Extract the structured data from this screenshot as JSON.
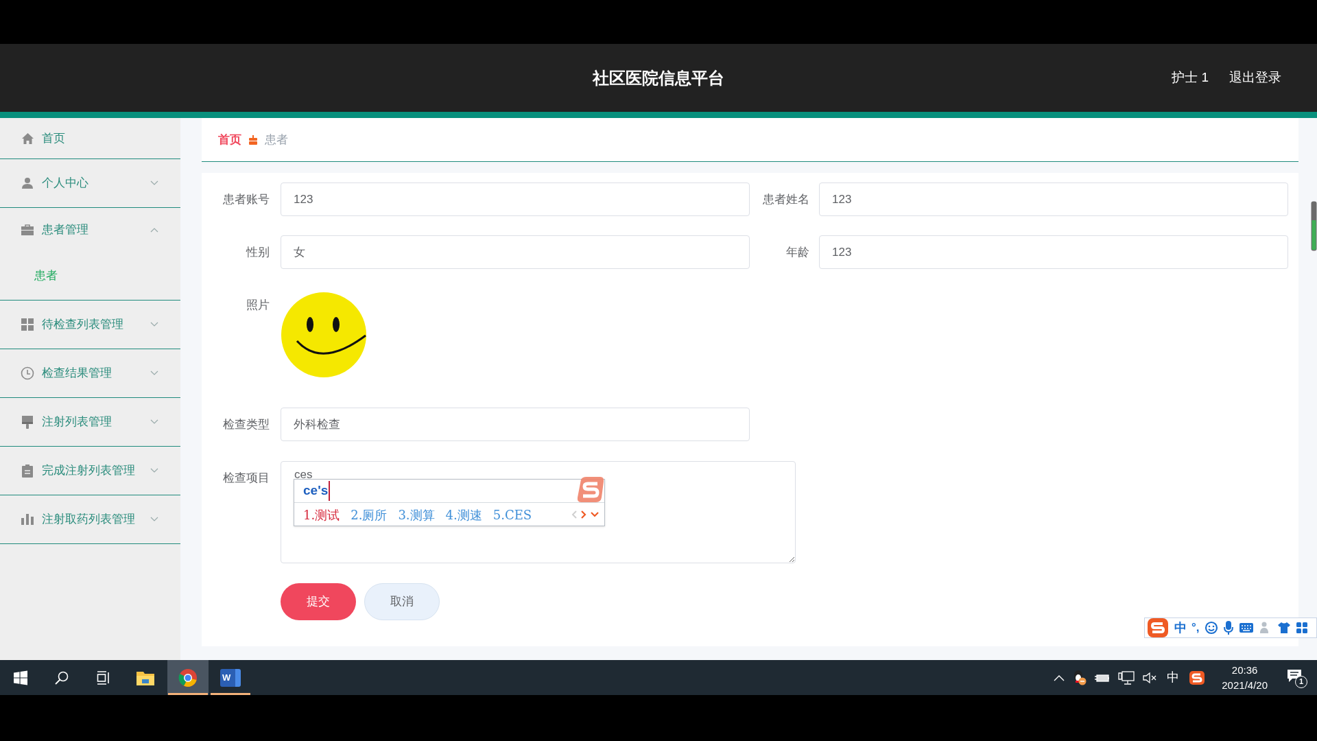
{
  "header": {
    "title": "社区医院信息平台",
    "user": "护士 1",
    "logout": "退出登录"
  },
  "sidebar": {
    "items": [
      {
        "kind": "link",
        "label": "首页"
      },
      {
        "kind": "menu",
        "label": "个人中心",
        "expanded": false
      },
      {
        "kind": "menu",
        "label": "患者管理",
        "expanded": true,
        "children": [
          {
            "label": "患者",
            "selected": true
          }
        ]
      },
      {
        "kind": "menu",
        "label": "待检查列表管理",
        "expanded": false
      },
      {
        "kind": "menu",
        "label": "检查结果管理",
        "expanded": false
      },
      {
        "kind": "menu",
        "label": "注射列表管理",
        "expanded": false
      },
      {
        "kind": "menu",
        "label": "完成注射列表管理",
        "expanded": false
      },
      {
        "kind": "menu",
        "label": "注射取药列表管理",
        "expanded": false
      }
    ]
  },
  "breadcrumb": [
    "首页",
    "患者"
  ],
  "form": {
    "rows": [
      [
        {
          "kind": "input",
          "label": "患者账号",
          "value": "123"
        },
        {
          "kind": "input",
          "label": "患者姓名",
          "value": "123"
        }
      ],
      [
        {
          "kind": "input",
          "label": "性别",
          "value": "女"
        },
        {
          "kind": "input",
          "label": "年龄",
          "value": "123"
        }
      ],
      [
        {
          "kind": "image",
          "label": "照片"
        }
      ],
      [
        {
          "kind": "input",
          "label": "检查类型",
          "value": "外科检查"
        }
      ],
      [
        {
          "kind": "textarea",
          "label": "检查项目",
          "value": "ces"
        }
      ]
    ],
    "buttons": [
      {
        "kind": "primary",
        "label": "提交"
      },
      {
        "kind": "secondary",
        "label": "取消"
      }
    ]
  },
  "ime": {
    "composition": "ce's",
    "candidates": [
      {
        "label": "1.测试",
        "selected": true
      },
      {
        "label": "2.厕所",
        "selected": false
      },
      {
        "label": "3.测算",
        "selected": false
      },
      {
        "label": "4.测速",
        "selected": false
      },
      {
        "label": "5.CES",
        "selected": false
      }
    ]
  },
  "ime_toolbar": {
    "mode": "中",
    "punctuation": "°,"
  },
  "taskbar": {
    "apps": [
      {
        "kind": "explorer",
        "selected": false,
        "running": false
      },
      {
        "kind": "chrome",
        "selected": true,
        "running": true
      },
      {
        "kind": "word",
        "letter": "W",
        "selected": false,
        "running": true
      }
    ],
    "tray": {
      "input_mode": "中",
      "time": "20:36",
      "date": "2021/4/20",
      "notifications": "1"
    }
  }
}
